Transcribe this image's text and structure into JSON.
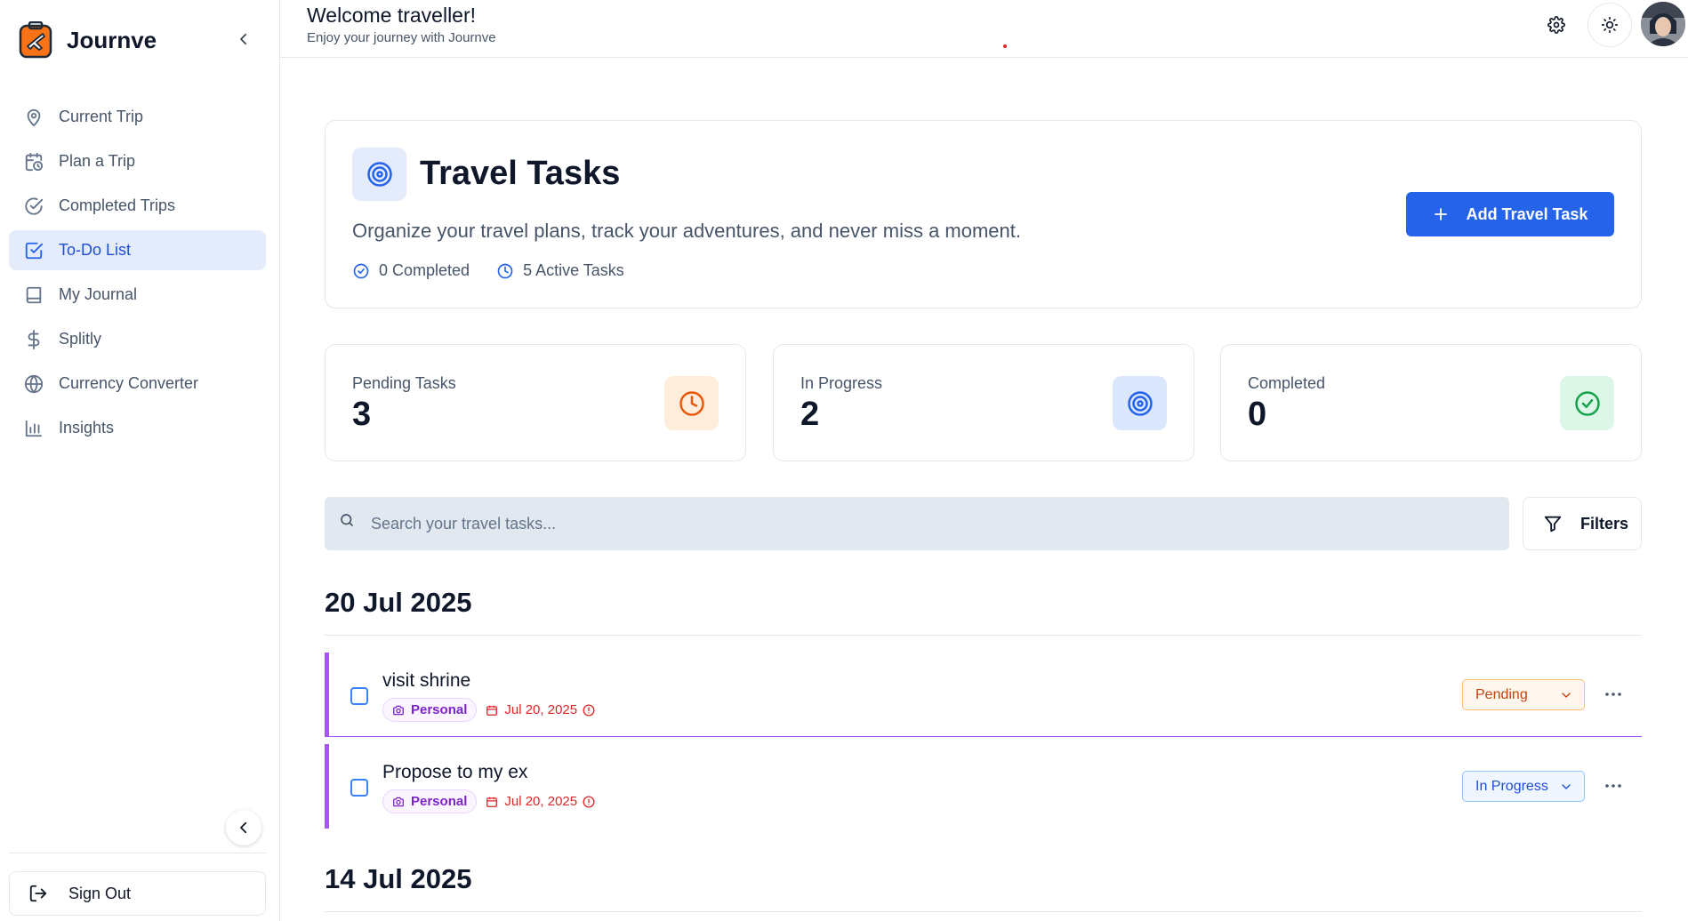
{
  "brand": {
    "name": "Journve"
  },
  "nav": {
    "items": [
      {
        "label": "Current Trip",
        "icon": "map-pin-icon"
      },
      {
        "label": "Plan a Trip",
        "icon": "calendar-clock-icon"
      },
      {
        "label": "Completed Trips",
        "icon": "check-circle-icon"
      },
      {
        "label": "To-Do List",
        "icon": "check-square-icon",
        "active": true
      },
      {
        "label": "My Journal",
        "icon": "book-icon"
      },
      {
        "label": "Splitly",
        "icon": "dollar-icon"
      },
      {
        "label": "Currency Converter",
        "icon": "globe-icon"
      },
      {
        "label": "Insights",
        "icon": "bar-chart-icon"
      }
    ],
    "sign_out": "Sign Out"
  },
  "header": {
    "welcome": "Welcome traveller!",
    "subtitle": "Enjoy your journey with Journve"
  },
  "hero": {
    "title": "Travel Tasks",
    "description": "Organize your travel plans, track your adventures, and never miss a moment.",
    "completed": "0 Completed",
    "active": "5 Active Tasks",
    "add_button": "Add Travel Task"
  },
  "stats": [
    {
      "label": "Pending Tasks",
      "value": "3",
      "icon": "clock-icon"
    },
    {
      "label": "In Progress",
      "value": "2",
      "icon": "target-icon"
    },
    {
      "label": "Completed",
      "value": "0",
      "icon": "check-circle-icon"
    }
  ],
  "search": {
    "placeholder": "Search your travel tasks..."
  },
  "filters_label": "Filters",
  "groups": [
    {
      "date": "20 Jul 2025",
      "tasks": [
        {
          "title": "visit shrine",
          "tag": "Personal",
          "due": "Jul 20, 2025",
          "status": "Pending"
        },
        {
          "title": "Propose to my ex",
          "tag": "Personal",
          "due": "Jul 20, 2025",
          "status": "In Progress"
        }
      ]
    },
    {
      "date": "14 Jul 2025",
      "tasks": []
    }
  ],
  "colors": {
    "accent": "#2563eb",
    "task_border": "#a855f7",
    "overdue": "#dc2626",
    "pending": "#c2410c",
    "completed": "#16a34a"
  }
}
